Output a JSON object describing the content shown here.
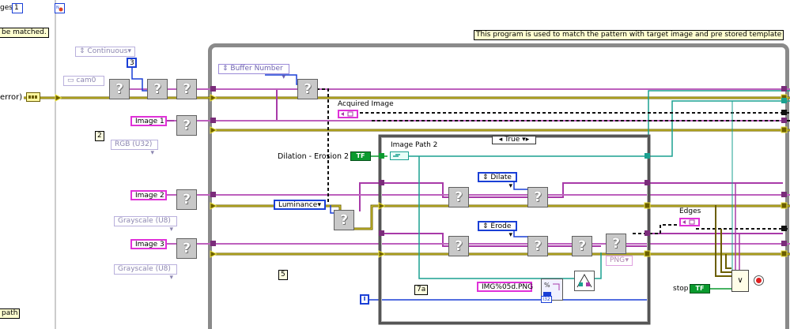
{
  "top_left": {
    "label_cut": "ges",
    "const_1": "1",
    "note_cut": "be matched.",
    "error_label": "error)",
    "path_note": "path"
  },
  "header_note": "This program is used to match the pattern with target image and pre stored template",
  "controls": {
    "acq_mode": "Continuous",
    "acq_const": "3",
    "camera": "cam0",
    "image1": "Image 1",
    "image1_type": "RGB (U32)",
    "image2": "Image 2",
    "image2_type": "Grayscale (U8)",
    "image3": "Image 3",
    "image3_type": "Grayscale (U8)",
    "buffer_number": "Buffer Number",
    "acquired_image": "Acquired Image",
    "luminance": "Luminance",
    "dilation_label": "Dilation - Erosion 2",
    "edges_label": "Edges",
    "stop_label": "stop",
    "bool_tf": "TF"
  },
  "inner": {
    "case_selector": "True",
    "image_path": "Image Path 2",
    "dilate": "Dilate",
    "erode": "Erode",
    "png": "PNG",
    "format_string": "IMG%05d.PNG",
    "iteration": "i",
    "iter_const": "I32"
  },
  "frame_labels": {
    "frame2": "2",
    "frame5": "5",
    "frame7a": "7a"
  },
  "colors": {
    "image_wire": "#c03cc0",
    "error_wire": "#c8b400",
    "int_wire": "#1a3fd6",
    "path_wire": "#1aa090",
    "bool_wire": "#0a9a2e",
    "loop_border": "#8a8a8a"
  }
}
